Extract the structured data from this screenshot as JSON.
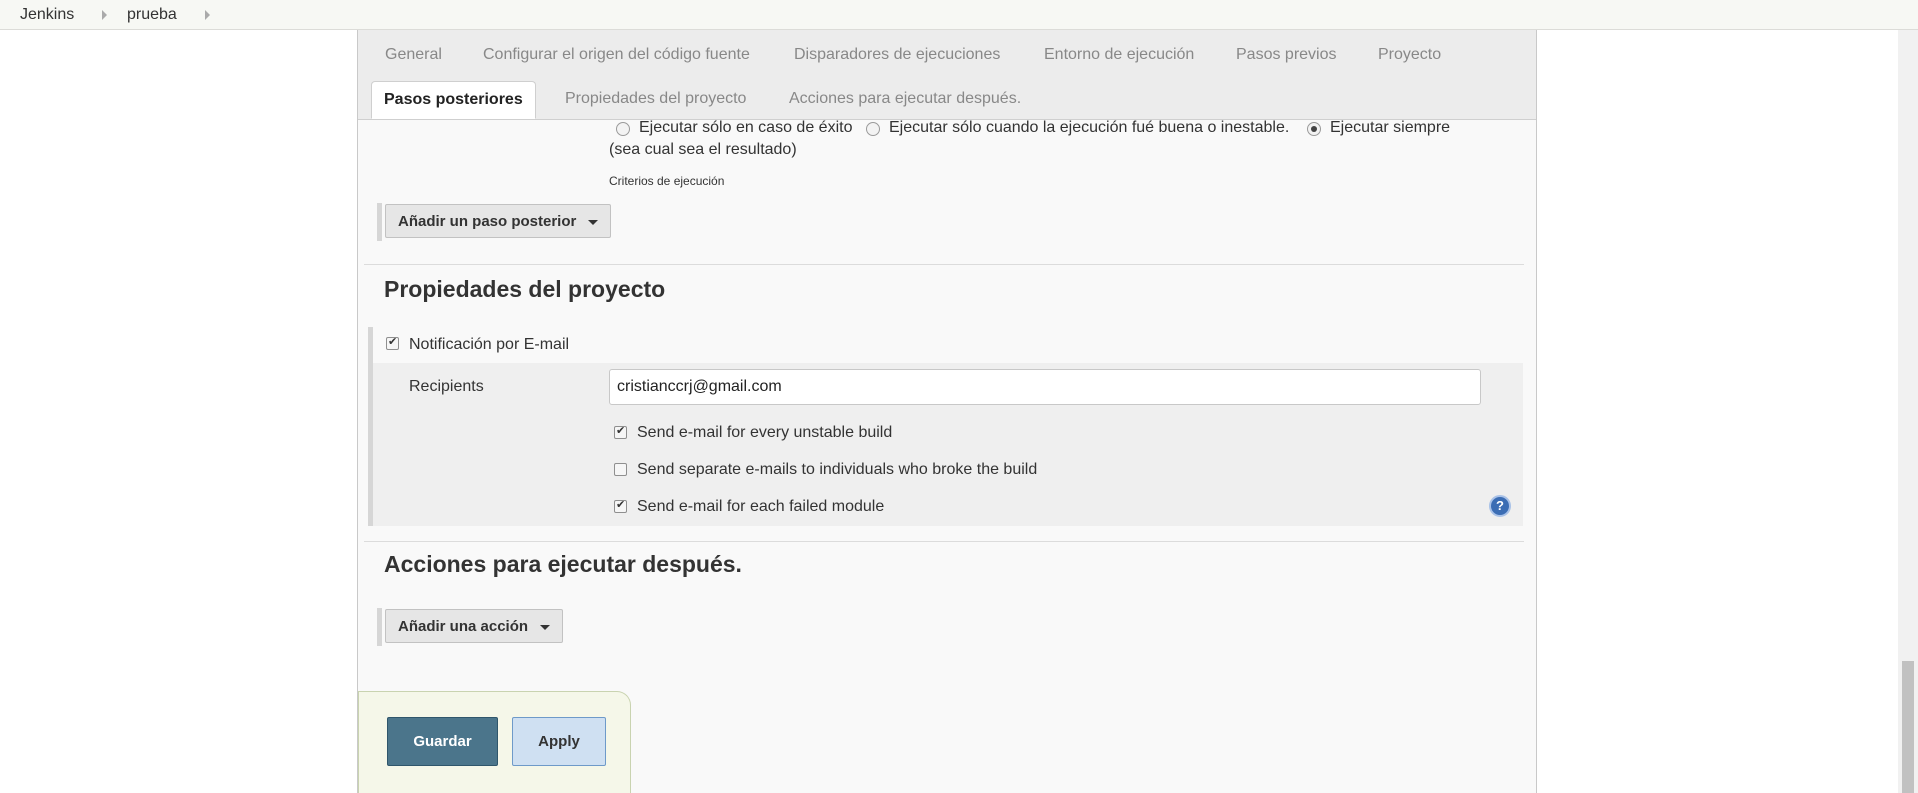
{
  "breadcrumb": {
    "items": [
      "Jenkins",
      "prueba"
    ]
  },
  "tabs": [
    "General",
    "Configurar el origen del código fuente",
    "Disparadores de ejecuciones",
    "Entorno de ejecución",
    "Pasos previos",
    "Proyecto",
    "Pasos posteriores",
    "Propiedades del proyecto",
    "Acciones para ejecutar después."
  ],
  "active_tab": "Pasos posteriores",
  "post_steps": {
    "radio_options": [
      "Ejecutar sólo en caso de éxito",
      "Ejecutar sólo cuando la ejecución fué buena o inestable.",
      "Ejecutar siempre"
    ],
    "radio_selected": "Ejecutar siempre",
    "radio_continuation": "(sea cual sea el resultado)",
    "criteria_label": "Criterios de ejecución",
    "add_button": "Añadir un paso posterior"
  },
  "project_properties": {
    "title": "Propiedades del proyecto",
    "email_notification_label": "Notificación por E-mail",
    "email_notification_checked": true,
    "recipients_label": "Recipients",
    "recipients_value": "cristianccrj@gmail.com",
    "options": [
      {
        "label": "Send e-mail for every unstable build",
        "checked": true
      },
      {
        "label": "Send separate e-mails to individuals who broke the build",
        "checked": false
      },
      {
        "label": "Send e-mail for each failed module",
        "checked": true
      }
    ],
    "help_icon": "?"
  },
  "post_actions": {
    "title": "Acciones para ejecutar después.",
    "add_button": "Añadir una acción"
  },
  "buttons": {
    "save": "Guardar",
    "apply": "Apply"
  },
  "colors": {
    "primary_button": "#4b758b",
    "secondary_button": "#cfe0f2",
    "help_icon": "#3b6db4"
  }
}
